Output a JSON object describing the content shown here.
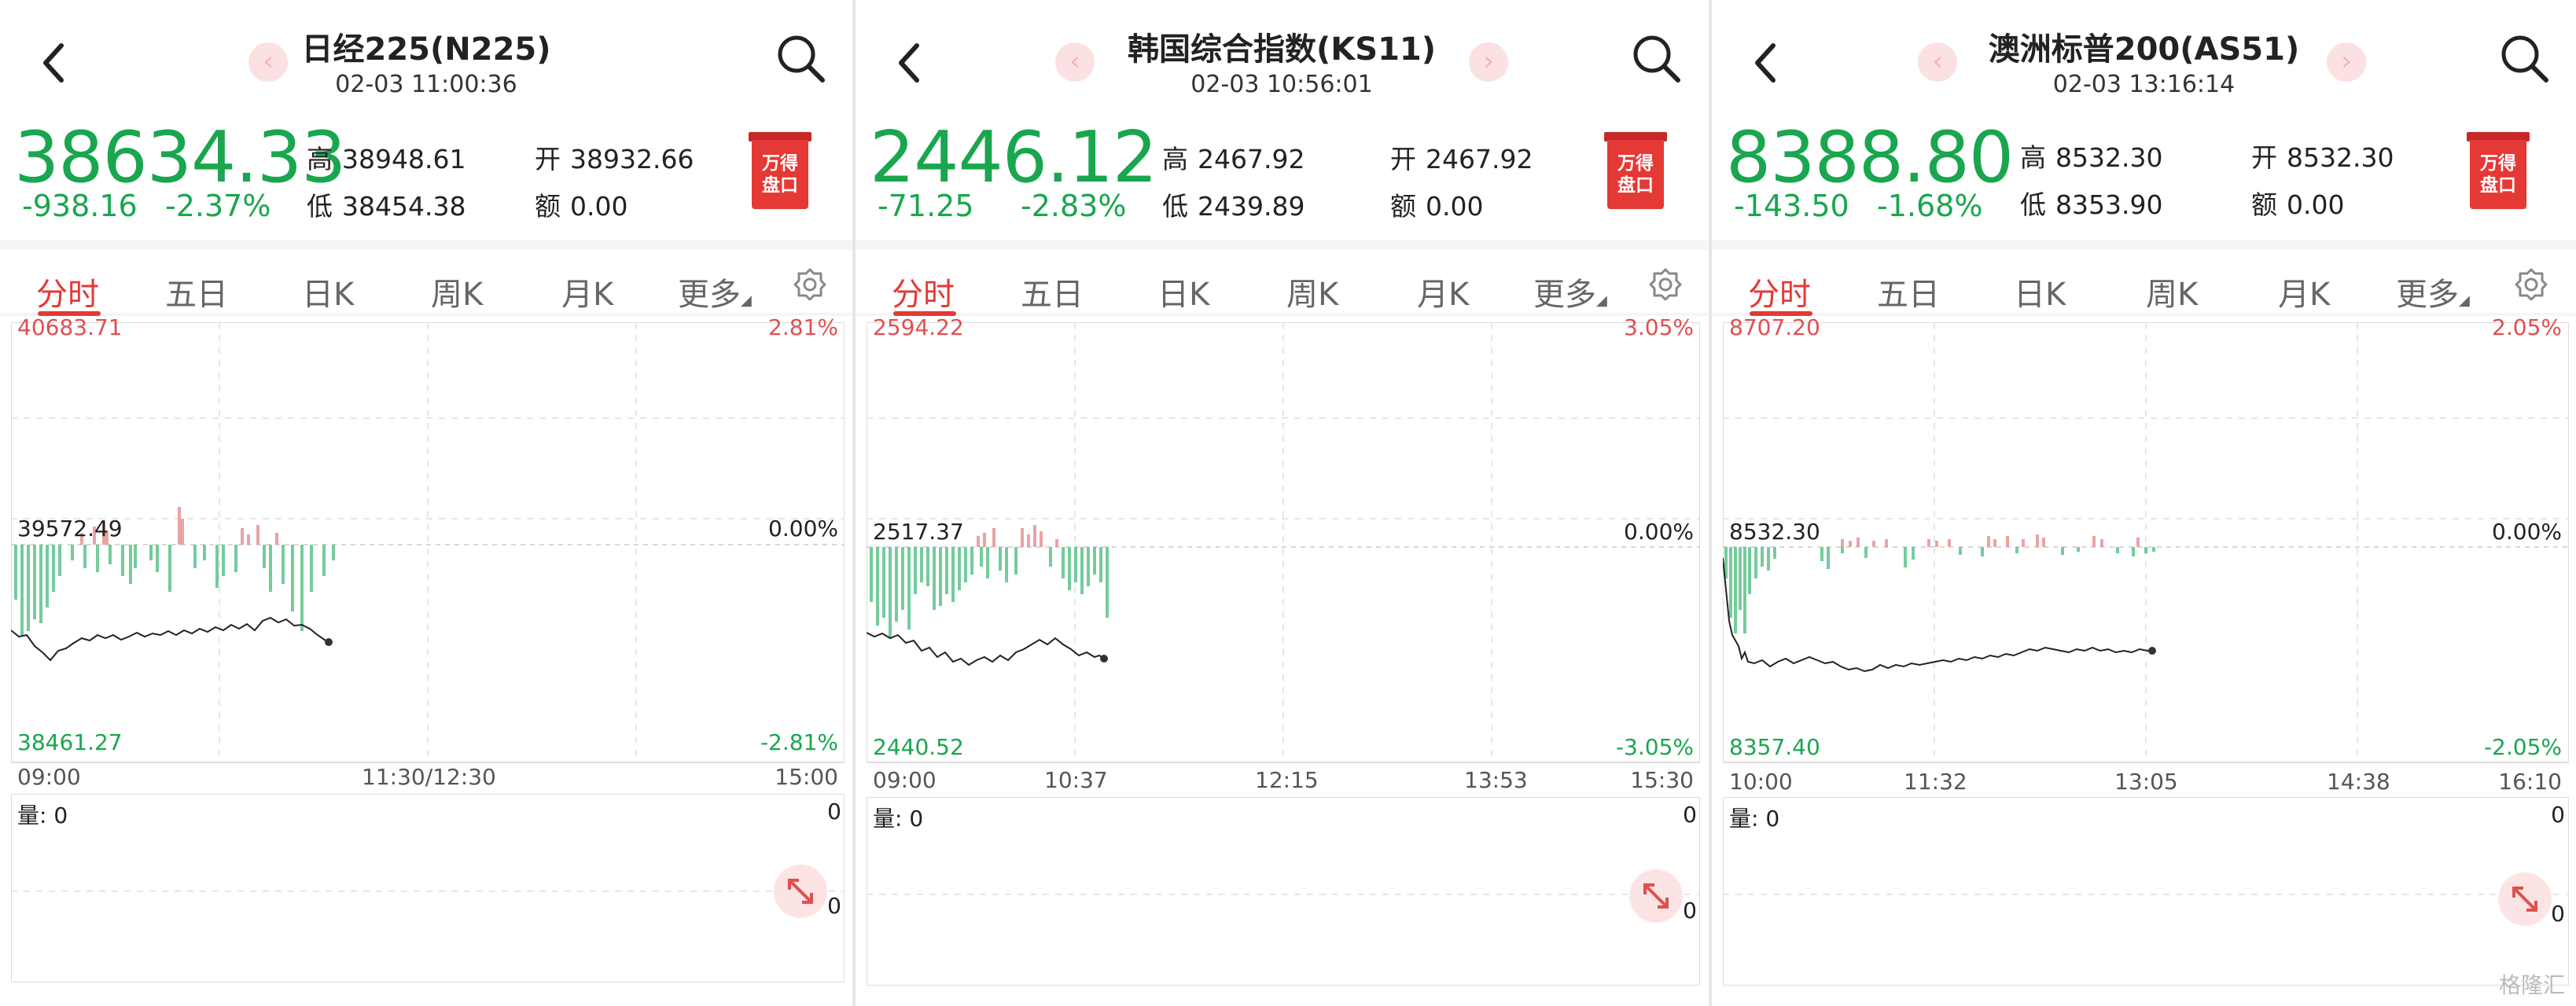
{
  "panels": [
    {
      "title": "日经225(N225)",
      "time": "02-03 11:00:36",
      "price": "38634.33",
      "change": "-938.16",
      "change_pct": "-2.37%",
      "high_label": "高",
      "high": "38948.61",
      "low_label": "低",
      "low": "38454.38",
      "open_label": "开",
      "open": "38932.66",
      "amount_label": "额",
      "amount": "0.00",
      "badge": [
        "万得",
        "盘口"
      ],
      "tabs": [
        "分时",
        "五日",
        "日K",
        "周K",
        "月K",
        "更多"
      ],
      "chart": {
        "top_price": "40683.71",
        "top_pct": "2.81%",
        "mid_price": "39572.49",
        "mid_pct": "0.00%",
        "bottom_price": "38461.27",
        "bottom_pct": "-2.81%",
        "time_ticks": [
          "09:00",
          "11:30/12:30",
          "15:00"
        ]
      },
      "volume": {
        "label": "量: 0",
        "right_top": "0",
        "right_bottom": "0"
      }
    },
    {
      "title": "韩国综合指数(KS11)",
      "time": "02-03 10:56:01",
      "price": "2446.12",
      "change": "-71.25",
      "change_pct": "-2.83%",
      "high_label": "高",
      "high": "2467.92",
      "low_label": "低",
      "low": "2439.89",
      "open_label": "开",
      "open": "2467.92",
      "amount_label": "额",
      "amount": "0.00",
      "badge": [
        "万得",
        "盘口"
      ],
      "tabs": [
        "分时",
        "五日",
        "日K",
        "周K",
        "月K",
        "更多"
      ],
      "chart": {
        "top_price": "2594.22",
        "top_pct": "3.05%",
        "mid_price": "2517.37",
        "mid_pct": "0.00%",
        "bottom_price": "2440.52",
        "bottom_pct": "-3.05%",
        "time_ticks": [
          "09:00",
          "10:37",
          "12:15",
          "13:53",
          "15:30"
        ]
      },
      "volume": {
        "label": "量: 0",
        "right_top": "0",
        "right_bottom": "0"
      }
    },
    {
      "title": "澳洲标普200(AS51)",
      "time": "02-03 13:16:14",
      "price": "8388.80",
      "change": "-143.50",
      "change_pct": "-1.68%",
      "high_label": "高",
      "high": "8532.30",
      "low_label": "低",
      "low": "8353.90",
      "open_label": "开",
      "open": "8532.30",
      "amount_label": "额",
      "amount": "0.00",
      "badge": [
        "万得",
        "盘口"
      ],
      "tabs": [
        "分时",
        "五日",
        "日K",
        "周K",
        "月K",
        "更多"
      ],
      "chart": {
        "top_price": "8707.20",
        "top_pct": "2.05%",
        "mid_price": "8532.30",
        "mid_pct": "0.00%",
        "bottom_price": "8357.40",
        "bottom_pct": "-2.05%",
        "time_ticks": [
          "10:00",
          "11:32",
          "13:05",
          "14:38",
          "16:10"
        ]
      },
      "volume": {
        "label": "量: 0",
        "right_top": "0",
        "right_bottom": "0"
      }
    }
  ],
  "colors": {
    "up": "#e05050",
    "down": "#1aa64e",
    "accent": "#e53935"
  },
  "icons": [
    "back-icon",
    "search-icon",
    "prev-icon",
    "next-icon",
    "gear-icon",
    "expand-icon"
  ],
  "watermark": "格隆汇"
}
